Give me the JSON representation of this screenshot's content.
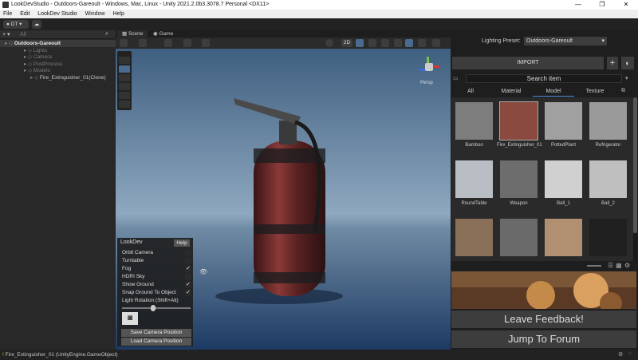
{
  "window": {
    "title": "LookDevStudio - Outdoors-Gareoult - Windows, Mac, Linux - Unity 2021.2.0b3.3078.7 Personal <DX11>",
    "min": "—",
    "max": "❐",
    "close": "✕"
  },
  "menu": [
    "File",
    "Edit",
    "LookDev Studio",
    "Window",
    "Help"
  ],
  "toolbar": {
    "account": "DT",
    "add": "+ ▾",
    "search_placeholder": "All"
  },
  "hierarchy": {
    "rows": [
      {
        "label": "Outdoors-Gareoult",
        "indent": 6,
        "bold": true
      },
      {
        "label": "Lights",
        "indent": 30,
        "dim": true
      },
      {
        "label": "Camera",
        "indent": 30,
        "dim": true
      },
      {
        "label": "PostProcess",
        "indent": 30,
        "dim": true
      },
      {
        "label": "Models",
        "indent": 30,
        "dim": true
      },
      {
        "label": "Fire_Extinguisher_01(Clone)",
        "indent": 38
      }
    ]
  },
  "scene": {
    "tab_scene": "Scene",
    "tab_game": "Game",
    "toggle_2d": "2D",
    "persp": "Persp"
  },
  "lookdev": {
    "title": "LookDev",
    "help": "Help",
    "options": [
      {
        "label": "Orbit Camera",
        "checked": false
      },
      {
        "label": "Turntable",
        "checked": false
      },
      {
        "label": "Fog",
        "checked": true
      },
      {
        "label": "HDRI Sky",
        "checked": false
      },
      {
        "label": "Show Ground",
        "checked": true
      },
      {
        "label": "Snap Ground To Object",
        "checked": true
      }
    ],
    "light_rotation": "Light Rotation (Shift+Alt)",
    "light_rotation_value": 0.45,
    "save": "Save Camera Position",
    "load": "Load Camera Position"
  },
  "right": {
    "preset_label": "Lighting Preset:",
    "preset_value": "Outdoors-Gareoult",
    "import": "IMPORT",
    "search": "Search item",
    "tabs": [
      "All",
      "Material",
      "Model",
      "Texture"
    ],
    "active_tab": "Model",
    "items": [
      {
        "label": "Bamboo",
        "color": "#7d7d7d"
      },
      {
        "label": "Fire_Extinguisher_01",
        "color": "#8a4a40"
      },
      {
        "label": "PottedPlant",
        "color": "#a0a0a0"
      },
      {
        "label": "Refrigerator",
        "color": "#9a9a9a"
      },
      {
        "label": "RoundTable",
        "color": "#b8bec4"
      },
      {
        "label": "Weapon",
        "color": "#6d6d6d"
      },
      {
        "label": "Ball_1",
        "color": "#d0d0d0"
      },
      {
        "label": "Ball_2",
        "color": "#bfbfbf"
      },
      {
        "label": "",
        "color": "#8a7058"
      },
      {
        "label": "",
        "color": "#6a6a6a"
      },
      {
        "label": "",
        "color": "#b09070"
      },
      {
        "label": "",
        "color": "#202020"
      }
    ],
    "feedback": "Leave Feedback!",
    "forum": "Jump To Forum"
  },
  "status": {
    "text": "Fire_Extinguisher_01 (UnityEngine.GameObject)"
  }
}
